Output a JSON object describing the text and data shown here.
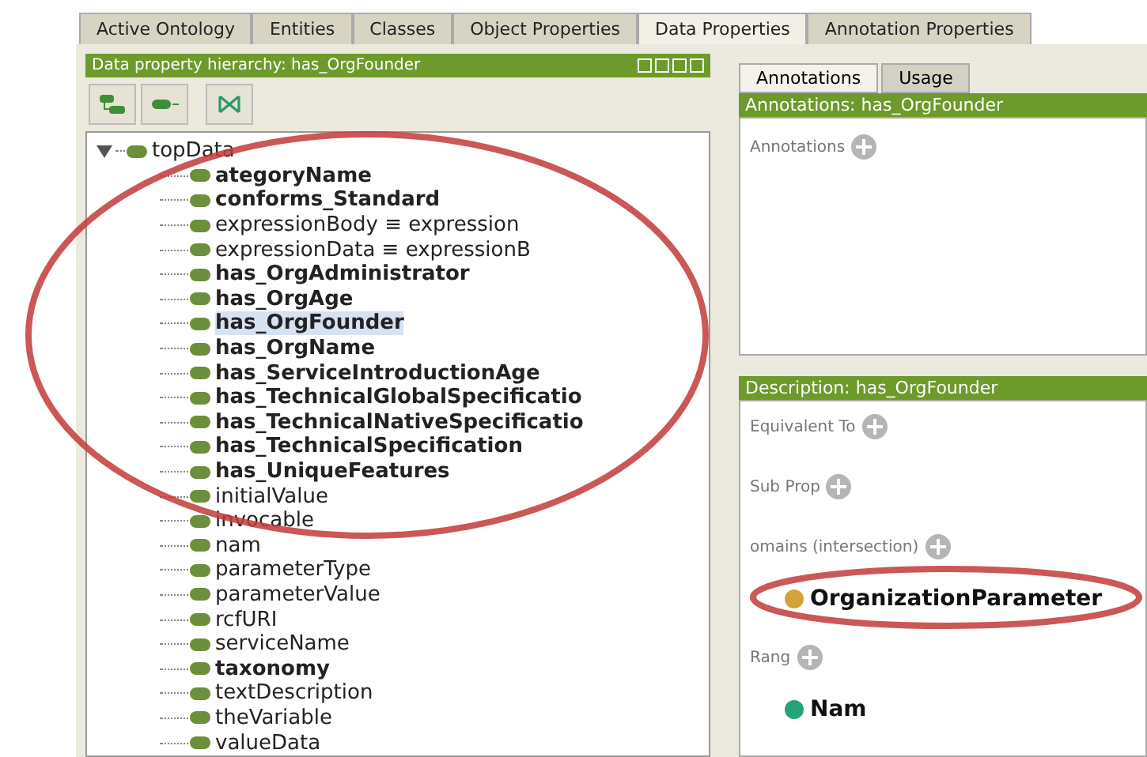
{
  "tabs": [
    {
      "label": "Active Ontology",
      "selected": false
    },
    {
      "label": "Entities",
      "selected": false
    },
    {
      "label": "Classes",
      "selected": false
    },
    {
      "label": "Object Properties",
      "selected": false
    },
    {
      "label": "Data Properties",
      "selected": true
    },
    {
      "label": "Annotation Properties",
      "selected": false
    }
  ],
  "hierarchy": {
    "title": "Data property hierarchy: has_OrgFounder",
    "root": {
      "label": "topData",
      "expanded": true,
      "children": [
        {
          "label": "ategoryName",
          "bold": true,
          "selected": false
        },
        {
          "label": "conforms_Standard",
          "bold": true,
          "selected": false
        },
        {
          "label": "expressionBody ≡ expression",
          "bold": false,
          "selected": false
        },
        {
          "label": "expressionData ≡ expressionB",
          "bold": false,
          "selected": false
        },
        {
          "label": "has_OrgAdministrator",
          "bold": true,
          "selected": false
        },
        {
          "label": "has_OrgAge",
          "bold": true,
          "selected": false
        },
        {
          "label": "has_OrgFounder",
          "bold": true,
          "selected": true
        },
        {
          "label": "has_OrgName",
          "bold": true,
          "selected": false
        },
        {
          "label": "has_ServiceIntroductionAge",
          "bold": true,
          "selected": false
        },
        {
          "label": "has_TechnicalGlobalSpecificatio",
          "bold": true,
          "selected": false
        },
        {
          "label": "has_TechnicalNativeSpecificatio",
          "bold": true,
          "selected": false
        },
        {
          "label": "has_TechnicalSpecification",
          "bold": true,
          "selected": false
        },
        {
          "label": "has_UniqueFeatures",
          "bold": true,
          "selected": false
        },
        {
          "label": "initialValue",
          "bold": false,
          "selected": false
        },
        {
          "label": "invocable",
          "bold": false,
          "selected": false
        },
        {
          "label": "nam",
          "bold": false,
          "selected": false
        },
        {
          "label": "parameterType",
          "bold": false,
          "selected": false
        },
        {
          "label": "parameterValue",
          "bold": false,
          "selected": false
        },
        {
          "label": "rcfURI",
          "bold": false,
          "selected": false
        },
        {
          "label": "serviceName",
          "bold": false,
          "selected": false
        },
        {
          "label": "taxonomy",
          "bold": true,
          "selected": false
        },
        {
          "label": "textDescription",
          "bold": false,
          "selected": false
        },
        {
          "label": "theVariable",
          "bold": false,
          "selected": false
        },
        {
          "label": "valueData",
          "bold": false,
          "selected": false
        }
      ]
    }
  },
  "annotations": {
    "tabs": [
      {
        "label": "Annotations",
        "selected": true
      },
      {
        "label": "Usage",
        "selected": false
      }
    ],
    "title": "Annotations: has_OrgFounder",
    "section": "Annotations"
  },
  "description": {
    "title": "Description: has_OrgFounder",
    "sections": [
      {
        "label": "Equivalent To"
      },
      {
        "label": "Sub Prop"
      },
      {
        "label": "omains (intersection)",
        "items": [
          {
            "name": "OrganizationParameter",
            "color": "#d4a23a"
          }
        ]
      },
      {
        "label": "Rang",
        "items": [
          {
            "name": "Nam",
            "color": "#23a37a"
          }
        ]
      }
    ]
  }
}
